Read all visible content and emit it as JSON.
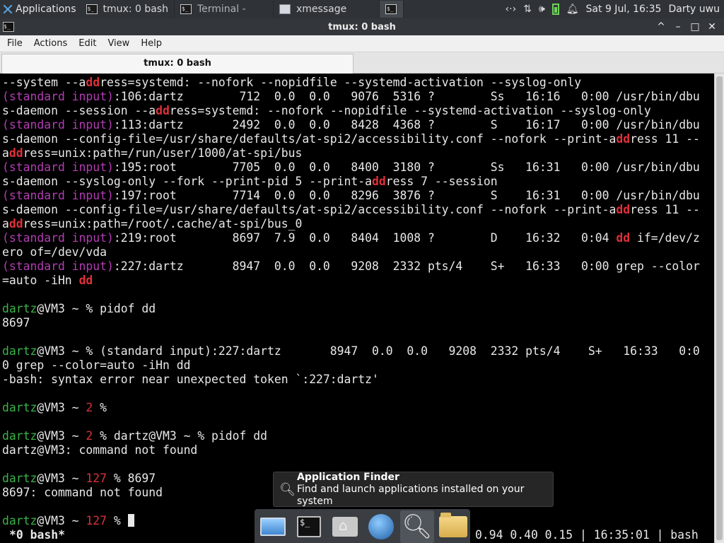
{
  "panel": {
    "applications_label": "Applications",
    "tasks": [
      {
        "label": "tmux: 0 bash",
        "icon": "terminal-icon"
      },
      {
        "label": "Terminal -",
        "icon": "terminal-icon"
      },
      {
        "label": "xmessage",
        "icon": "xmessage-window-icon"
      }
    ],
    "clock": "Sat  9 Jul, 16:35",
    "user": "Darty uwu",
    "tray_icons": [
      "network-icon",
      "transfer-icon",
      "volume-icon",
      "battery-icon",
      "notification-bell-icon"
    ]
  },
  "window": {
    "title": "tmux: 0 bash",
    "controls": [
      "^",
      "–",
      "□",
      "✕"
    ]
  },
  "menubar": [
    "File",
    "Actions",
    "Edit",
    "View",
    "Help"
  ],
  "tab": {
    "label": "tmux: 0 bash"
  },
  "terminal": {
    "lines": [
      [
        {
          "t": "--system --a"
        },
        {
          "t": "dd",
          "c": "red"
        },
        {
          "t": "ress=systemd: --nofork --nopidfile --systemd-activation --syslog-only"
        }
      ],
      [
        {
          "t": "(standard input)",
          "c": "mag"
        },
        {
          "t": ":106:dartz        712  0.0  0.0   9076  5316 ?        Ss   16:16   0:00 /usr/bin/dbu"
        }
      ],
      [
        {
          "t": "s-daemon --session --a"
        },
        {
          "t": "dd",
          "c": "red"
        },
        {
          "t": "ress=systemd: --nofork --nopidfile --systemd-activation --syslog-only"
        }
      ],
      [
        {
          "t": "(standard input)",
          "c": "mag"
        },
        {
          "t": ":113:dartz       2492  0.0  0.0   8428  4368 ?        S    16:17   0:00 /usr/bin/dbu"
        }
      ],
      [
        {
          "t": "s-daemon --config-file=/usr/share/defaults/at-spi2/accessibility.conf --nofork --print-a"
        },
        {
          "t": "dd",
          "c": "red"
        },
        {
          "t": "ress 11 --"
        }
      ],
      [
        {
          "t": "a"
        },
        {
          "t": "dd",
          "c": "red"
        },
        {
          "t": "ress=unix:path=/run/user/1000/at-spi/bus"
        }
      ],
      [
        {
          "t": "(standard input)",
          "c": "mag"
        },
        {
          "t": ":195:root        7705  0.0  0.0   8400  3180 ?        Ss   16:31   0:00 /usr/bin/dbu"
        }
      ],
      [
        {
          "t": "s-daemon --syslog-only --fork --print-pid 5 --print-a"
        },
        {
          "t": "dd",
          "c": "red"
        },
        {
          "t": "ress 7 --session"
        }
      ],
      [
        {
          "t": "(standard input)",
          "c": "mag"
        },
        {
          "t": ":197:root        7714  0.0  0.0   8296  3876 ?        S    16:31   0:00 /usr/bin/dbu"
        }
      ],
      [
        {
          "t": "s-daemon --config-file=/usr/share/defaults/at-spi2/accessibility.conf --nofork --print-a"
        },
        {
          "t": "dd",
          "c": "red"
        },
        {
          "t": "ress 11 --"
        }
      ],
      [
        {
          "t": "a"
        },
        {
          "t": "dd",
          "c": "red"
        },
        {
          "t": "ress=unix:path=/root/.cache/at-spi/bus_0"
        }
      ],
      [
        {
          "t": "(standard input)",
          "c": "mag"
        },
        {
          "t": ":219:root        8697  7.9  0.0   8404  1008 ?        D    16:32   0:04 "
        },
        {
          "t": "dd",
          "c": "red"
        },
        {
          "t": " if=/dev/z"
        }
      ],
      [
        {
          "t": "ero of=/dev/vda"
        }
      ],
      [
        {
          "t": "(standard input)",
          "c": "mag"
        },
        {
          "t": ":227:dartz       8947  0.0  0.0   9208  2332 pts/4    S+   16:33   0:00 grep --color"
        }
      ],
      [
        {
          "t": "=auto -iHn "
        },
        {
          "t": "dd",
          "c": "red"
        }
      ],
      [],
      [
        {
          "t": "dartz",
          "c": "grn"
        },
        {
          "t": "@VM3 ~ % pidof dd"
        }
      ],
      [
        {
          "t": "8697"
        }
      ],
      [],
      [
        {
          "t": "dartz",
          "c": "grn"
        },
        {
          "t": "@VM3 ~ % (standard input):227:dartz       8947  0.0  0.0   9208  2332 pts/4    S+   16:33   0:0"
        }
      ],
      [
        {
          "t": "0 grep --color=auto -iHn dd"
        }
      ],
      [
        {
          "t": "-bash: syntax error near unexpected token `:227:dartz'"
        }
      ],
      [],
      [
        {
          "t": "dartz",
          "c": "grn"
        },
        {
          "t": "@VM3 ~ "
        },
        {
          "t": "2",
          "c": "err"
        },
        {
          "t": " %"
        }
      ],
      [],
      [
        {
          "t": "dartz",
          "c": "grn"
        },
        {
          "t": "@VM3 ~ "
        },
        {
          "t": "2",
          "c": "err"
        },
        {
          "t": " % dartz@VM3 ~ % pidof dd"
        }
      ],
      [
        {
          "t": "dartz@VM3: command not found"
        }
      ],
      [],
      [
        {
          "t": "dartz",
          "c": "grn"
        },
        {
          "t": "@VM3 ~ "
        },
        {
          "t": "127",
          "c": "err"
        },
        {
          "t": " % 8697"
        }
      ],
      [
        {
          "t": "8697: command not found"
        }
      ],
      [],
      [
        {
          "t": "dartz",
          "c": "grn"
        },
        {
          "t": "@VM3 ~ "
        },
        {
          "t": "127",
          "c": "err"
        },
        {
          "t": " % "
        },
        {
          "cursor": true
        }
      ]
    ]
  },
  "tmux_status": {
    "left": "*0 bash*",
    "right": "0.94 0.40 0.15 | 16:35:01 | bash"
  },
  "tooltip": {
    "title": "Application Finder",
    "description": "Find and launch applications installed on your system",
    "icon": "magnifier-icon"
  },
  "dock": {
    "launchers": [
      "show-desktop-icon",
      "terminal-icon",
      "home-folder-icon",
      "web-browser-icon",
      "app-finder-icon",
      "files-folder-icon"
    ],
    "terminal_icon_glyph": "$_"
  },
  "colors": {
    "panel_bg": "#2f3338",
    "terminal_bg": "#000000",
    "grep_match": "#e0313a",
    "grep_filename": "#b43cb4",
    "prompt_user": "#3bb24a"
  }
}
